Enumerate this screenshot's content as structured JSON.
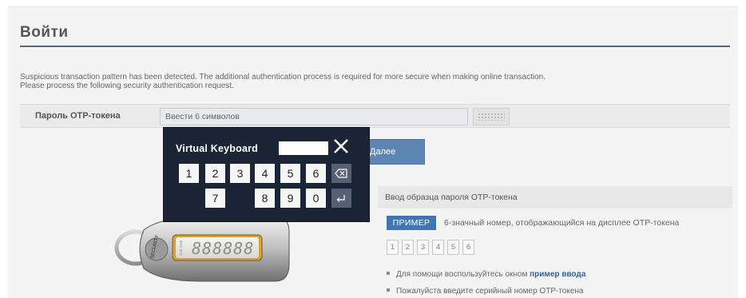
{
  "page": {
    "title": "Войти",
    "notice_line1": "Suspicious transaction pattern has been detected. The additional authentication process is required for more secure when making online transaction.",
    "notice_line2": "Please process the following security authentication request."
  },
  "otp": {
    "label": "Пароль OTP-токена",
    "placeholder": "Ввести 6 символов",
    "value": ""
  },
  "submit": {
    "label": "Далее"
  },
  "help": {
    "title": "Ввод образца пароля OTP-токена",
    "example_badge": "ПРИМЕР",
    "example_text": "6-значный номер, отображающийся на дисплее OTP-токена",
    "digits": [
      "1",
      "2",
      "3",
      "4",
      "5",
      "6"
    ],
    "bullet1_prefix": "Для помощи воспользуйтесь окном ",
    "bullet1_link": "пример ввода",
    "bullet2": "Пожалуйста введите серийный номер OTP-токена"
  },
  "token": {
    "display": "888888",
    "brand": "SECURITY",
    "side_label": "ONE TIME"
  },
  "virtual_keyboard": {
    "title": "Virtual Keyboard",
    "row1": [
      "1",
      "2",
      "3",
      "4",
      "5",
      "6"
    ],
    "row2": [
      "7",
      "8",
      "9",
      "0"
    ],
    "close_icon": "close-icon",
    "backspace_icon": "backspace-icon",
    "enter_icon": "enter-icon"
  },
  "colors": {
    "accent": "#3f77b5",
    "button": "#5d86b4",
    "keyboard_bg": "#1c2536",
    "rule": "#56667a"
  }
}
